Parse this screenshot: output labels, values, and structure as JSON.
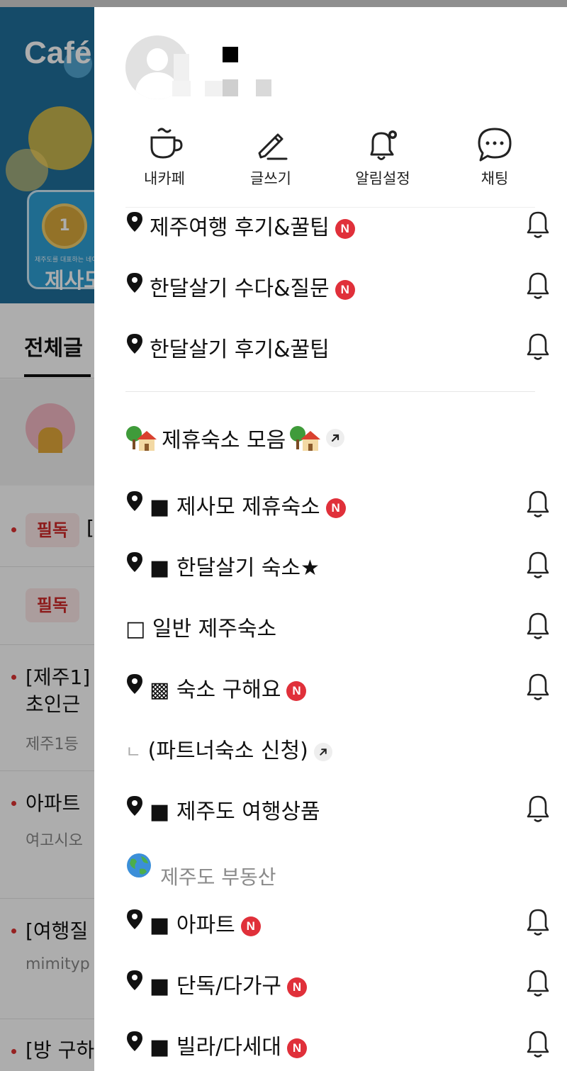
{
  "background": {
    "logo_text": "Café",
    "badge_title": "제사모",
    "badge_sub": "제주도를 대표하는 네이버",
    "medal_number": "1",
    "tab_all": "전체글",
    "posts": [
      {
        "tag": "필독",
        "title": "[",
        "sub": ""
      },
      {
        "tag": "필독",
        "title": "",
        "sub": ""
      },
      {
        "tag": "",
        "title": "[제주1]",
        "title2": "초인근",
        "sub": "제주1등"
      },
      {
        "tag": "",
        "title": "아파트",
        "sub": "여고시오"
      },
      {
        "tag": "",
        "title": "[여행질",
        "sub": "mimityp"
      },
      {
        "tag": "",
        "title": "[방 구하",
        "sub": ""
      }
    ]
  },
  "drawer": {
    "quick_menu": [
      {
        "icon": "cup-icon",
        "label": "내카페"
      },
      {
        "icon": "pencil-icon",
        "label": "글쓰기"
      },
      {
        "icon": "bell-settings-icon",
        "label": "알림설정"
      },
      {
        "icon": "chat-icon",
        "label": "채팅"
      }
    ],
    "boards_top": [
      {
        "label": "제주여행 후기&꿀팁",
        "new": "N"
      },
      {
        "label": "한달살기 수다&질문",
        "new": "N"
      },
      {
        "label": "한달살기 후기&꿀팁",
        "new": ""
      }
    ],
    "group_lodging": {
      "title": "제휴숙소 모음"
    },
    "boards_lodging": [
      {
        "prefix": "■",
        "label": "제사모 제휴숙소",
        "new": "N"
      },
      {
        "prefix": "■",
        "label": "한달살기 숙소★",
        "new": ""
      },
      {
        "prefix": "□",
        "label": "일반 제주숙소",
        "new": ""
      },
      {
        "prefix": "▩",
        "label": "숙소 구해요",
        "new": "N"
      }
    ],
    "partner_link": {
      "prefix": "ㄴ",
      "label": "(파트너숙소 신청)"
    },
    "travel_product": {
      "prefix": "■",
      "label": "제주도 여행상품"
    },
    "group_realestate": {
      "title": "제주도 부동산"
    },
    "boards_realestate": [
      {
        "prefix": "■",
        "label": "아파트",
        "new": "N"
      },
      {
        "prefix": "■",
        "label": "단독/다가구",
        "new": "N"
      },
      {
        "prefix": "■",
        "label": "빌라/다세대",
        "new": "N"
      }
    ]
  }
}
